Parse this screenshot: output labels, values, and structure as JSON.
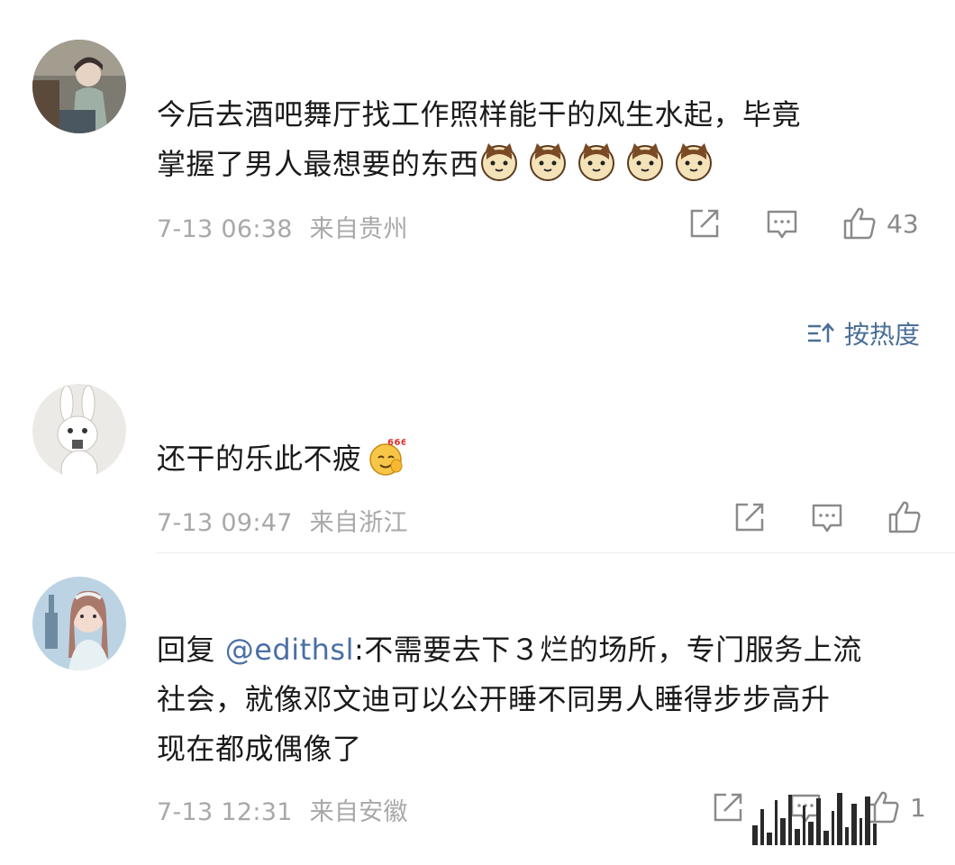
{
  "comments": [
    {
      "text_line1": "今后去酒吧舞厅找工作照样能干的风生水起，毕竟",
      "text_line2": "掌握了男人最想要的东西",
      "emojis": [
        "cat-emoji",
        "cat-emoji",
        "cat-emoji",
        "cat-emoji",
        "cat-emoji"
      ],
      "time": "7-13 06:38",
      "location": "来自贵州",
      "likes": "43"
    },
    {
      "text": "还干的乐此不疲",
      "emoji": "666-emoji",
      "time": "7-13 09:47",
      "location": "来自浙江",
      "likes": ""
    },
    {
      "reply_prefix": "回复 ",
      "mention": "@edithsl",
      "text_line1": ":不需要去下３烂的场所，专门服务上流",
      "text_line2": "社会，就像邓文迪可以公开睡不同男人睡得步步高升",
      "text_line3": "现在都成偶像了",
      "time": "7-13 12:31",
      "location": "来自安徽",
      "likes": "1"
    }
  ],
  "sort": {
    "label": "按热度",
    "icon": "sort-icon"
  },
  "colors": {
    "accent": "#4a6f96",
    "meta": "#a8a8a8",
    "icon": "#8a8a8a"
  }
}
